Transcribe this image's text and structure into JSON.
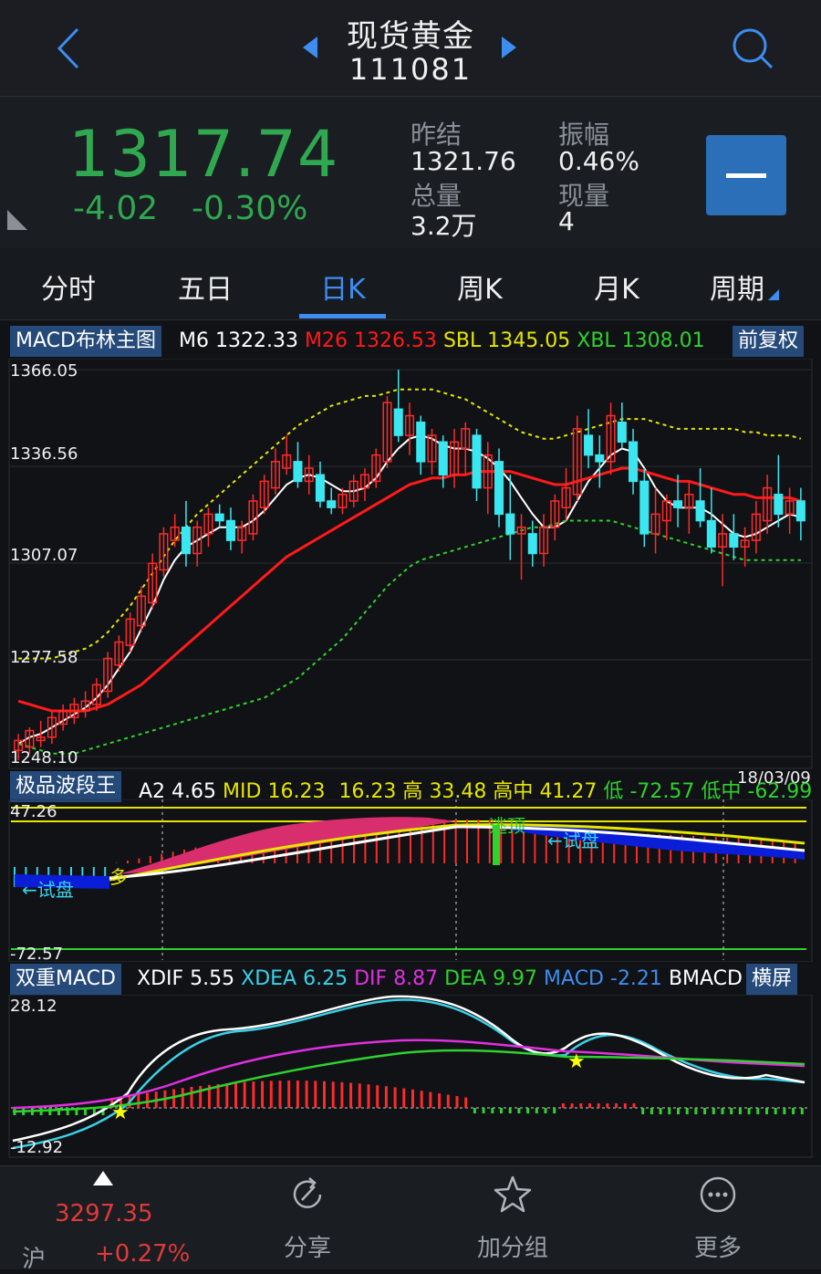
{
  "header": {
    "title": "现货黄金",
    "code": "111081"
  },
  "quote": {
    "price": "1317.74",
    "change": "-4.02",
    "change_pct": "-0.30%",
    "prev_close_label": "昨结",
    "prev_close": "1321.76",
    "amplitude_label": "振幅",
    "amplitude": "0.46%",
    "volume_label": "总量",
    "volume": "3.2万",
    "current_vol_label": "现量",
    "current_vol": "4",
    "color_down": "#2fa84f"
  },
  "tabs": [
    {
      "label": "分时"
    },
    {
      "label": "五日"
    },
    {
      "label": "日K"
    },
    {
      "label": "周K"
    },
    {
      "label": "月K"
    },
    {
      "label": "周期"
    }
  ],
  "active_tab": "日K",
  "main_chart": {
    "label": "MACD布林主图",
    "adjust_button": "前复权",
    "m6_label": "M6",
    "m6": "1322.33",
    "m26_label": "M26",
    "m26": "1326.53",
    "sbl_label": "SBL",
    "sbl": "1345.05",
    "xbl_label": "XBL",
    "xbl": "1308.01",
    "y_ticks": [
      "1366.05",
      "1336.56",
      "1307.07",
      "1277.58",
      "1248.10"
    ],
    "date": "18/03/09"
  },
  "wave_panel": {
    "label": "极品波段王",
    "a2_label": "A2",
    "a2": "4.65",
    "mid_label": "MID",
    "mid": "16.23",
    "v2": "16.23",
    "high_label": "高",
    "high": "33.48",
    "highmid_label": "高中",
    "highmid": "41.27",
    "low_label": "低",
    "low": "-72.57",
    "lowmid_label": "低中",
    "lowmid": "-62.99",
    "y_top": "47.26",
    "y_bottom": "-72.57",
    "annotations": {
      "trial1": "←试盘",
      "multi": "多",
      "top": "逃顶",
      "trial2": "←试盘"
    }
  },
  "macd_panel": {
    "label": "双重MACD",
    "xdif_label": "XDIF",
    "xdif": "5.55",
    "xdea_label": "XDEA",
    "xdea": "6.25",
    "dif_label": "DIF",
    "dif": "8.87",
    "dea_label": "DEA",
    "dea": "9.97",
    "macd_label": "MACD",
    "macd": "-2.21",
    "bmacd_label": "BMACD",
    "landscape_button": "横屏",
    "y_top": "28.12",
    "y_bottom": "-12.92"
  },
  "chart_data": {
    "type": "candlestick",
    "ylim": [
      1248.1,
      1366.05
    ],
    "y_ticks": [
      1366.05,
      1336.56,
      1307.07,
      1277.58,
      1248.1
    ],
    "candles_ohlc": [
      [
        1250,
        1255,
        1247,
        1253
      ],
      [
        1251,
        1257,
        1249,
        1256
      ],
      [
        1253,
        1259,
        1251,
        1254
      ],
      [
        1254,
        1262,
        1252,
        1260
      ],
      [
        1258,
        1264,
        1256,
        1262
      ],
      [
        1260,
        1266,
        1258,
        1264
      ],
      [
        1262,
        1268,
        1260,
        1265
      ],
      [
        1264,
        1272,
        1262,
        1270
      ],
      [
        1268,
        1280,
        1266,
        1278
      ],
      [
        1276,
        1285,
        1274,
        1283
      ],
      [
        1282,
        1292,
        1280,
        1290
      ],
      [
        1288,
        1300,
        1286,
        1297
      ],
      [
        1295,
        1310,
        1293,
        1307
      ],
      [
        1305,
        1318,
        1303,
        1316
      ],
      [
        1314,
        1322,
        1312,
        1318
      ],
      [
        1318,
        1326,
        1306,
        1310
      ],
      [
        1310,
        1320,
        1306,
        1318
      ],
      [
        1316,
        1324,
        1312,
        1322
      ],
      [
        1322,
        1325,
        1318,
        1320
      ],
      [
        1320,
        1324,
        1311,
        1314
      ],
      [
        1314,
        1320,
        1310,
        1318
      ],
      [
        1316,
        1328,
        1314,
        1326
      ],
      [
        1324,
        1334,
        1322,
        1332
      ],
      [
        1330,
        1342,
        1328,
        1338
      ],
      [
        1336,
        1346,
        1334,
        1340
      ],
      [
        1338,
        1344,
        1330,
        1332
      ],
      [
        1332,
        1340,
        1328,
        1336
      ],
      [
        1334,
        1338,
        1324,
        1326
      ],
      [
        1326,
        1330,
        1322,
        1324
      ],
      [
        1324,
        1330,
        1322,
        1328
      ],
      [
        1326,
        1334,
        1324,
        1332
      ],
      [
        1330,
        1336,
        1326,
        1334
      ],
      [
        1332,
        1342,
        1330,
        1340
      ],
      [
        1338,
        1358,
        1336,
        1356
      ],
      [
        1354,
        1366,
        1344,
        1346
      ],
      [
        1346,
        1356,
        1340,
        1352
      ],
      [
        1350,
        1352,
        1334,
        1338
      ],
      [
        1338,
        1348,
        1334,
        1346
      ],
      [
        1344,
        1346,
        1330,
        1334
      ],
      [
        1334,
        1348,
        1330,
        1344
      ],
      [
        1342,
        1350,
        1334,
        1348
      ],
      [
        1346,
        1348,
        1326,
        1330
      ],
      [
        1330,
        1344,
        1322,
        1340
      ],
      [
        1338,
        1342,
        1318,
        1322
      ],
      [
        1322,
        1334,
        1308,
        1316
      ],
      [
        1316,
        1322,
        1302,
        1318
      ],
      [
        1316,
        1320,
        1306,
        1310
      ],
      [
        1310,
        1322,
        1306,
        1318
      ],
      [
        1318,
        1328,
        1314,
        1326
      ],
      [
        1324,
        1336,
        1320,
        1330
      ],
      [
        1328,
        1352,
        1326,
        1348
      ],
      [
        1346,
        1354,
        1336,
        1340
      ],
      [
        1340,
        1346,
        1330,
        1338
      ],
      [
        1338,
        1356,
        1334,
        1352
      ],
      [
        1350,
        1356,
        1342,
        1344
      ],
      [
        1344,
        1348,
        1328,
        1332
      ],
      [
        1332,
        1336,
        1312,
        1316
      ],
      [
        1316,
        1330,
        1310,
        1322
      ],
      [
        1320,
        1328,
        1314,
        1326
      ],
      [
        1326,
        1334,
        1318,
        1324
      ],
      [
        1324,
        1332,
        1316,
        1328
      ],
      [
        1326,
        1336,
        1318,
        1320
      ],
      [
        1320,
        1330,
        1310,
        1312
      ],
      [
        1312,
        1322,
        1300,
        1316
      ],
      [
        1316,
        1322,
        1308,
        1312
      ],
      [
        1312,
        1318,
        1306,
        1314
      ],
      [
        1314,
        1326,
        1310,
        1322
      ],
      [
        1320,
        1334,
        1316,
        1330
      ],
      [
        1328,
        1340,
        1318,
        1322
      ],
      [
        1322,
        1330,
        1316,
        1326
      ],
      [
        1326,
        1330,
        1314,
        1320
      ]
    ],
    "series": [
      {
        "name": "M6",
        "color": "#ffffff",
        "values": [
          1252,
          1254,
          1255,
          1257,
          1259,
          1261,
          1263,
          1266,
          1270,
          1275,
          1280,
          1287,
          1294,
          1302,
          1308,
          1312,
          1314,
          1316,
          1318,
          1318,
          1318,
          1320,
          1323,
          1327,
          1331,
          1333,
          1334,
          1333,
          1331,
          1329,
          1329,
          1330,
          1333,
          1338,
          1342,
          1345,
          1346,
          1345,
          1343,
          1342,
          1342,
          1341,
          1339,
          1336,
          1332,
          1327,
          1322,
          1318,
          1318,
          1320,
          1326,
          1332,
          1336,
          1340,
          1342,
          1341,
          1336,
          1330,
          1326,
          1324,
          1324,
          1324,
          1322,
          1319,
          1316,
          1315,
          1316,
          1318,
          1320,
          1322,
          1321
        ]
      },
      {
        "name": "M26",
        "color": "#ff1a1a",
        "values": [
          1265,
          1264,
          1263,
          1262,
          1262,
          1262,
          1262,
          1263,
          1264,
          1266,
          1268,
          1270,
          1273,
          1276,
          1279,
          1282,
          1285,
          1288,
          1291,
          1294,
          1297,
          1300,
          1303,
          1306,
          1309,
          1311,
          1313,
          1315,
          1317,
          1319,
          1321,
          1323,
          1325,
          1327,
          1329,
          1331,
          1332,
          1333,
          1333,
          1334,
          1334,
          1335,
          1335,
          1335,
          1335,
          1334,
          1333,
          1332,
          1331,
          1331,
          1332,
          1333,
          1334,
          1335,
          1336,
          1336,
          1335,
          1334,
          1333,
          1332,
          1332,
          1331,
          1330,
          1329,
          1328,
          1328,
          1327,
          1327,
          1327,
          1327,
          1326
        ]
      },
      {
        "name": "SBL",
        "color": "#e6e600",
        "values": [
          1278,
          1278,
          1278,
          1278,
          1279,
          1280,
          1281,
          1283,
          1286,
          1290,
          1294,
          1299,
          1304,
          1309,
          1314,
          1318,
          1322,
          1325,
          1328,
          1331,
          1334,
          1337,
          1340,
          1343,
          1346,
          1349,
          1351,
          1353,
          1355,
          1356,
          1357,
          1358,
          1358,
          1359,
          1360,
          1360,
          1360,
          1360,
          1359,
          1358,
          1357,
          1355,
          1353,
          1351,
          1349,
          1347,
          1346,
          1345,
          1345,
          1346,
          1347,
          1348,
          1349,
          1350,
          1351,
          1351,
          1351,
          1350,
          1349,
          1348,
          1348,
          1348,
          1348,
          1348,
          1348,
          1347,
          1347,
          1346,
          1346,
          1346,
          1345
        ]
      },
      {
        "name": "XBL",
        "color": "#2fd12f",
        "values": [
          1252,
          1251,
          1250,
          1249,
          1249,
          1249,
          1250,
          1251,
          1252,
          1253,
          1254,
          1255,
          1256,
          1257,
          1258,
          1259,
          1260,
          1261,
          1262,
          1263,
          1264,
          1265,
          1266,
          1268,
          1270,
          1272,
          1275,
          1278,
          1281,
          1284,
          1288,
          1292,
          1296,
          1300,
          1303,
          1306,
          1308,
          1309,
          1310,
          1311,
          1312,
          1313,
          1314,
          1315,
          1316,
          1317,
          1318,
          1318,
          1319,
          1320,
          1320,
          1320,
          1320,
          1320,
          1319,
          1318,
          1317,
          1316,
          1315,
          1314,
          1313,
          1312,
          1311,
          1310,
          1309,
          1308,
          1308,
          1308,
          1308,
          1308,
          1308
        ]
      }
    ]
  }
}
